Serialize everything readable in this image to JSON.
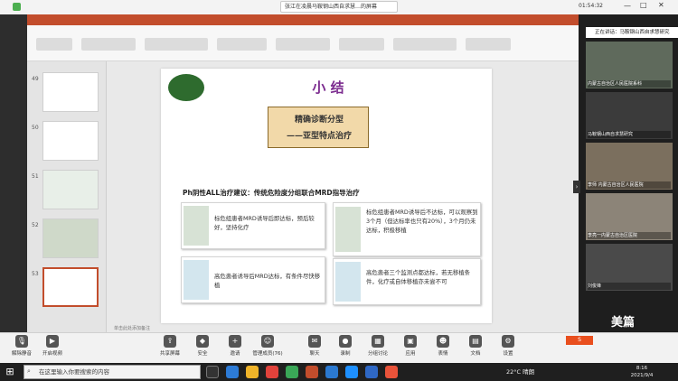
{
  "meeting": {
    "title": "张江在凌晨马鞍钢山西自求慧…的屏幕",
    "timer": "01:54:32"
  },
  "slide": {
    "title": "小 结",
    "topic_line1": "精确诊断分型",
    "topic_line2": "——亚型特点治疗",
    "heading": "Ph阴性ALL治疗建议：传统危险度分组联合MRD指导治疗",
    "cards": [
      {
        "text": "标危组患者MRD诱导后即达标，预后较好，坚持化疗",
        "color": "#d7e2d5"
      },
      {
        "text": "标危组患者MRD诱导后不达标，可以观察到3个月（但达标率也只有20%），3个月仍未达标，积极移植",
        "color": "#d7e2d5"
      },
      {
        "text": "高危患者诱导后MRD达标，有条件尽快移植",
        "color": "#d3e6ee"
      },
      {
        "text": "高危患者三个监测点都达标，若无移植条件，化疗或自体移植亦未尝不可",
        "color": "#d3e6ee"
      }
    ],
    "footer": "单击此处添加备注",
    "thumb_numbers": [
      "49",
      "50",
      "51",
      "52",
      "53"
    ]
  },
  "panel": {
    "header": "正在讲话：马鞍钢山西自求慧研究",
    "participants": [
      "内蒙古自治区人民医院系科",
      "马鞍钢山西自求慧研究",
      "李师 内蒙古自治区人民医院",
      "李亮一内蒙古自治区医院",
      "刘俊锋"
    ],
    "watermark": "美篇"
  },
  "toolbar": {
    "items": [
      {
        "label": "解除静音",
        "icon": "microphone-icon"
      },
      {
        "label": "开启视频",
        "icon": "camera-icon"
      },
      {
        "label": "共享屏幕",
        "icon": "share-screen-icon"
      },
      {
        "label": "安全",
        "icon": "shield-icon"
      },
      {
        "label": "邀请",
        "icon": "invite-icon"
      },
      {
        "label": "管理成员(76)",
        "icon": "members-icon"
      },
      {
        "label": "聊天",
        "icon": "chat-icon"
      },
      {
        "label": "录制",
        "icon": "record-icon"
      },
      {
        "label": "分组讨论",
        "icon": "breakout-icon"
      },
      {
        "label": "应用",
        "icon": "apps-icon"
      },
      {
        "label": "表情",
        "icon": "emoji-icon"
      },
      {
        "label": "文档",
        "icon": "document-icon"
      },
      {
        "label": "设置",
        "icon": "gear-icon"
      }
    ]
  },
  "taskbar": {
    "search_placeholder": "在这里输入你要搜索的内容",
    "weather": "22°C 晴朗",
    "time": "8:16",
    "date": "2021/9/4"
  }
}
